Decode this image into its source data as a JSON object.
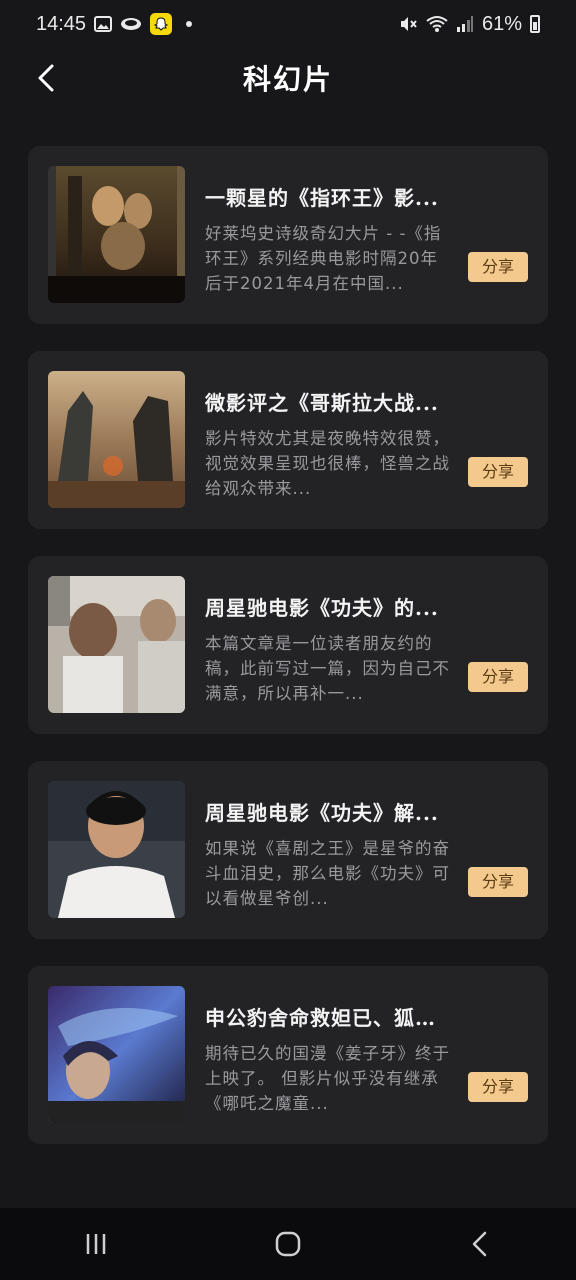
{
  "status_bar": {
    "time": "14:45",
    "battery": "61%",
    "icons": [
      "gallery-icon",
      "cloud-icon",
      "snapchat-icon",
      "mute-icon",
      "wifi-icon",
      "signal-icon",
      "battery-icon"
    ]
  },
  "header": {
    "title": "科幻片",
    "back_icon": "chevron-left-icon"
  },
  "articles": [
    {
      "title": "一颗星的《指环王》影...",
      "description": "好莱坞史诗级奇幻大片 - -《指环王》系列经典电影时隔20年后于2021年4月在中国...",
      "share_label": "分享"
    },
    {
      "title": "微影评之《哥斯拉大战...",
      "description": "影片特效尤其是夜晚特效很赞，视觉效果呈现也很棒，怪兽之战给观众带来...",
      "share_label": "分享"
    },
    {
      "title": "周星驰电影《功夫》的...",
      "description": "本篇文章是一位读者朋友约的稿，此前写过一篇，因为自己不满意，所以再补一...",
      "share_label": "分享"
    },
    {
      "title": "周星驰电影《功夫》解...",
      "description": "如果说《喜剧之王》是星爷的奋斗血泪史，那么电影《功夫》可以看做星爷创...",
      "share_label": "分享"
    },
    {
      "title": "申公豹舍命救妲已、狐妖...",
      "description": "期待已久的国漫《姜子牙》终于上映了。     但影片似乎没有继承《哪吒之魔童...",
      "share_label": "分享"
    }
  ],
  "nav_bar": {
    "icons": [
      "recents-icon",
      "home-icon",
      "back-icon"
    ]
  },
  "colors": {
    "background": "#17171a",
    "card": "#232326",
    "accent": "#f4c98d"
  }
}
